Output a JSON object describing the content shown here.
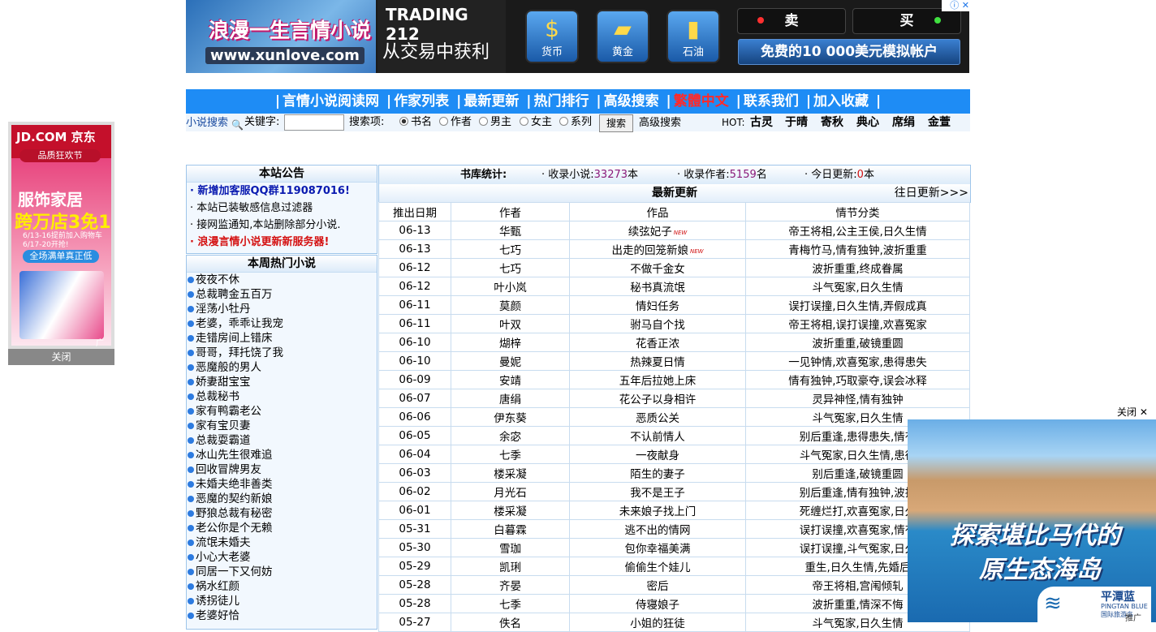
{
  "top_ad": {
    "brand_line1": "浪漫一生言情小说",
    "brand_line2": "www.xunlove.com",
    "trading_title": "TRADING 212",
    "trading_slogan": "从交易中获利",
    "tiles": [
      {
        "icon": "dollar-icon",
        "glyph": "$",
        "label": "货币"
      },
      {
        "icon": "gold-bar-icon",
        "glyph": "▰",
        "label": "黄金"
      },
      {
        "icon": "oil-barrel-icon",
        "glyph": "▮",
        "label": "石油"
      }
    ],
    "sell_label": "卖",
    "buy_label": "买",
    "demo_label": "免费的10 000美元模拟帐户",
    "ad_marker": "ⓘ ✕"
  },
  "nav": {
    "items": [
      "言情小说阅读网",
      "作家列表",
      "最新更新",
      "热门排行",
      "高级搜索",
      "繁體中文",
      "联系我们",
      "加入收藏"
    ],
    "separator": "|",
    "highlight_color": "#ff2a2a"
  },
  "search": {
    "label": "小说搜索",
    "keyword_label": "关键字:",
    "keyword_value": "",
    "field_label": "搜索项:",
    "options": [
      "书名",
      "作者",
      "男主",
      "女主",
      "系列"
    ],
    "selected_option": "书名",
    "button_label": "搜索",
    "advanced_label": "高级搜索",
    "hot_label": "HOT:",
    "hot_words": [
      "古灵",
      "于晴",
      "寄秋",
      "典心",
      "席绢",
      "金萱"
    ]
  },
  "left_ad": {
    "brand": "JD.COM 京东",
    "festival": "品质狂欢节",
    "headline1": "服饰家居",
    "headline2": "跨万店3免1",
    "dates": "6/13-16提前加入购物车 6/17-20开抢!",
    "cta": "全场满单真正低",
    "ad_tag": "广告",
    "close_label": "关闭"
  },
  "notice": {
    "title": "本站公告",
    "items": [
      "· 新增加客服QQ群119087016!",
      "· 本站已装敏感信息过滤器",
      "· 接网监通知,本站删除部分小说.",
      "· 浪漫言情小说更新新服务器!"
    ]
  },
  "hot_novels": {
    "title": "本周热门小说",
    "items": [
      "夜夜不休",
      "总裁聘金五百万",
      "淫荡小牡丹",
      "老婆，乖乖让我宠",
      "走错房间上错床",
      "哥哥，拜托饶了我",
      "恶魔般的男人",
      "娇妻甜宝宝",
      "总裁秘书",
      "家有鸭霸老公",
      "家有宝贝妻",
      "总裁耍霸道",
      "冰山先生很难追",
      "回收冒牌男友",
      "未婚夫绝非善类",
      "恶魔的契约新娘",
      "野狼总裁有秘密",
      "老公你是个无赖",
      "流氓未婚夫",
      "小心大老婆",
      "同居一下又何妨",
      "祸水红颜",
      "诱拐徒儿",
      "老婆好恰"
    ]
  },
  "stats": {
    "title": "书库统计:",
    "novels_label": "· 收录小说:",
    "novels_count": "33273",
    "novels_unit": "本",
    "authors_label": "· 收录作者:",
    "authors_count": "5159",
    "authors_unit": "名",
    "today_label": "· 今日更新:",
    "today_count": "0",
    "today_unit": "本"
  },
  "latest": {
    "title": "最新更新",
    "more_label": "往日更新>>>",
    "new_badge": "NEW",
    "columns": [
      "推出日期",
      "作者",
      "作品",
      "情节分类"
    ],
    "rows": [
      {
        "date": "06-13",
        "author": "华甄",
        "title": "续弦妃子",
        "is_new": true,
        "plot": "帝王将相,公主王侯,日久生情"
      },
      {
        "date": "06-13",
        "author": "七巧",
        "title": "出走的回笼新娘",
        "is_new": true,
        "plot": "青梅竹马,情有独钟,波折重重"
      },
      {
        "date": "06-12",
        "author": "七巧",
        "title": "不做千金女",
        "is_new": false,
        "plot": "波折重重,终成眷属"
      },
      {
        "date": "06-12",
        "author": "叶小岚",
        "title": "秘书真流氓",
        "is_new": false,
        "plot": "斗气冤家,日久生情"
      },
      {
        "date": "06-11",
        "author": "莫颜",
        "title": "情妇任务",
        "is_new": false,
        "plot": "误打误撞,日久生情,弄假成真"
      },
      {
        "date": "06-11",
        "author": "叶双",
        "title": "驸马自个找",
        "is_new": false,
        "plot": "帝王将相,误打误撞,欢喜冤家"
      },
      {
        "date": "06-10",
        "author": "煳梓",
        "title": "花香正浓",
        "is_new": false,
        "plot": "波折重重,破镜重圆"
      },
      {
        "date": "06-10",
        "author": "曼妮",
        "title": "热辣夏日情",
        "is_new": false,
        "plot": "一见钟情,欢喜冤家,患得患失"
      },
      {
        "date": "06-09",
        "author": "安靖",
        "title": "五年后拉她上床",
        "is_new": false,
        "plot": "情有独钟,巧取豪夺,误会冰释"
      },
      {
        "date": "06-07",
        "author": "唐绢",
        "title": "花公子以身相许",
        "is_new": false,
        "plot": "灵异神怪,情有独钟"
      },
      {
        "date": "06-06",
        "author": "伊东葵",
        "title": "恶质公关",
        "is_new": false,
        "plot": "斗气冤家,日久生情"
      },
      {
        "date": "06-05",
        "author": "余宓",
        "title": "不认前情人",
        "is_new": false,
        "plot": "别后重逢,患得患失,情有"
      },
      {
        "date": "06-04",
        "author": "七季",
        "title": "一夜献身",
        "is_new": false,
        "plot": "斗气冤家,日久生情,患得"
      },
      {
        "date": "06-03",
        "author": "楼采凝",
        "title": "陌生的妻子",
        "is_new": false,
        "plot": "别后重逢,破镜重圆"
      },
      {
        "date": "06-02",
        "author": "月光石",
        "title": "我不是王子",
        "is_new": false,
        "plot": "别后重逢,情有独钟,波折"
      },
      {
        "date": "06-01",
        "author": "楼采凝",
        "title": "未来娘子找上门",
        "is_new": false,
        "plot": "死缠烂打,欢喜冤家,日久"
      },
      {
        "date": "05-31",
        "author": "白暮霖",
        "title": "逃不出的情网",
        "is_new": false,
        "plot": "误打误撞,欢喜冤家,情有"
      },
      {
        "date": "05-30",
        "author": "雪珈",
        "title": "包你幸福美满",
        "is_new": false,
        "plot": "误打误撞,斗气冤家,日久"
      },
      {
        "date": "05-29",
        "author": "凯琍",
        "title": "偷偷生个娃儿",
        "is_new": false,
        "plot": "重生,日久生情,先婚后"
      },
      {
        "date": "05-28",
        "author": "齐晏",
        "title": "密后",
        "is_new": false,
        "plot": "帝王将相,宫闱倾轧"
      },
      {
        "date": "05-28",
        "author": "七季",
        "title": "侍寝娘子",
        "is_new": false,
        "plot": "波折重重,情深不悔"
      },
      {
        "date": "05-27",
        "author": "佚名",
        "title": "小姐的狂徒",
        "is_new": false,
        "plot": "斗气冤家,日久生情"
      }
    ]
  },
  "right_ad": {
    "close_label": "关闭 ✕",
    "headline1": "探索堪比马代的",
    "headline2": "原生态海岛",
    "brand": "平潭蓝",
    "brand_sub": "PINGTAN BLUE 国际旅游岛",
    "tag": "推广"
  }
}
